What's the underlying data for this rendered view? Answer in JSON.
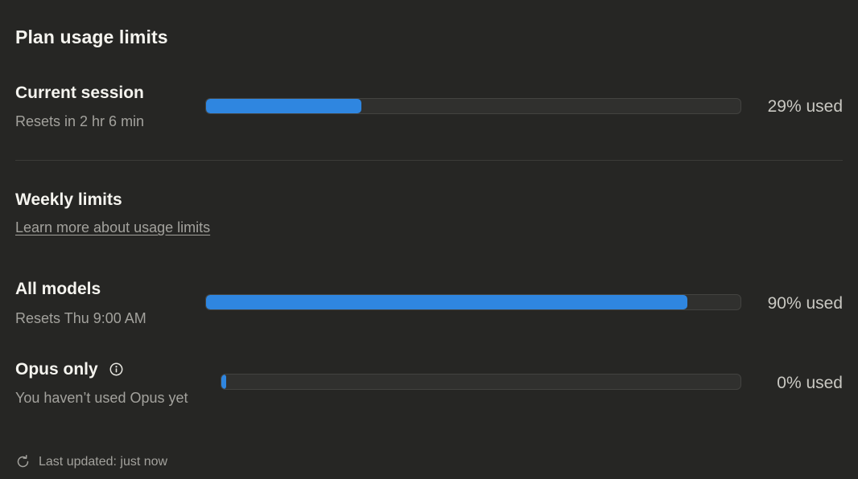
{
  "page": {
    "title": "Plan usage limits"
  },
  "current_session": {
    "title": "Current session",
    "subtitle": "Resets in 2 hr 6 min",
    "usage_percent": 29,
    "usage_label": "29% used"
  },
  "weekly": {
    "title": "Weekly limits",
    "learn_more_link": "Learn more about usage limits"
  },
  "all_models": {
    "title": "All models",
    "subtitle": "Resets Thu 9:00 AM",
    "usage_percent": 90,
    "usage_label": "90% used"
  },
  "opus_only": {
    "title": "Opus only",
    "subtitle": "You haven’t used Opus yet",
    "usage_percent": 0,
    "usage_label": "0% used",
    "info_icon": "info-icon"
  },
  "footer": {
    "last_updated": "Last updated: just now",
    "refresh_icon": "refresh-icon"
  },
  "colors": {
    "background": "#262624",
    "bar_fill": "#2f86e0",
    "bar_track": "#30302e",
    "text_primary": "#f5f4ef",
    "text_secondary": "#a3a29d"
  }
}
